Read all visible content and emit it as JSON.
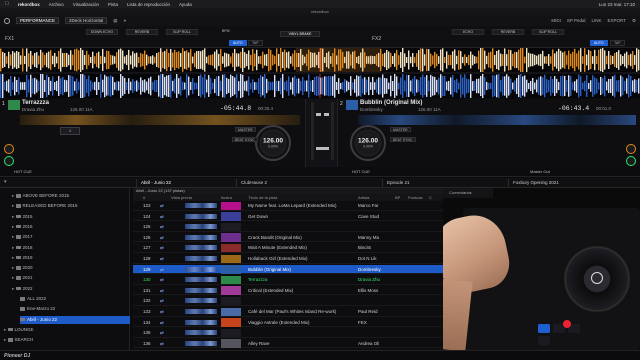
{
  "menubar": {
    "app": "rekordbox",
    "items": [
      "Archivo",
      "Visualización",
      "Pista",
      "Lista de reproducción",
      "Ayuda"
    ],
    "clock": "Lun 23 mar. 17:10"
  },
  "titlebar": {
    "title": "rekordbox"
  },
  "toolbar": {
    "mode": "PERFORMANCE",
    "layout": "2Deck Horizontal",
    "right_items": [
      "MIDI",
      "SP Pedal",
      "LINK",
      "EXPORT"
    ]
  },
  "fx": {
    "fx1": "FX1",
    "fx2": "FX2",
    "left_slots": [
      "DOWN ECHO",
      "REVERB",
      "SLIP ROLL"
    ],
    "right_slots": [
      "ECHO",
      "REVERB",
      "SLIP ROLL"
    ],
    "auto": "AUTO",
    "tap": "TAP",
    "bpm_label": "BPM",
    "center": "VINYL BRAKE"
  },
  "deck_a": {
    "number": "1",
    "title": "Terrazzza",
    "artist": "Dravia Zhu",
    "key_bpm": "126.00 11A",
    "remain": "-05:44.8",
    "elapsed": "00:30.4",
    "bpm": "126.00",
    "pct": "0.00%",
    "master": "MASTER",
    "beat_sync": "BEAT SYNC",
    "loop": "4",
    "hotcue": "HOT CUE"
  },
  "deck_b": {
    "number": "2",
    "title": "Bubblin (Original Mix)",
    "artist": "Dombresky",
    "key_bpm": "126.00 11A",
    "remain": "-06:43.4",
    "elapsed": "00:01.0",
    "bpm": "126.00",
    "pct": "0.00%",
    "master": "MASTER",
    "beat_sync": "BEAT SYNC",
    "hotcue": "HOT CUE"
  },
  "master_out": "Master Out",
  "browser": {
    "tabs": [
      "Abril - Junio 22",
      "ClubHause 2",
      "Episode 21",
      "Foxbury Opening 2021"
    ],
    "playlist_title": "Abril - Junio 22 (137 pistas)",
    "columns": [
      "#",
      "Vista previa",
      "Ilustra",
      "Título de la pista",
      "Artista",
      "BP",
      "Puntuac",
      "C",
      "Comentarios"
    ]
  },
  "tree": [
    {
      "label": "ABOVE BEFORE 2015",
      "indent": 1
    },
    {
      "label": "RELEASED BEFORE 2015",
      "indent": 1
    },
    {
      "label": "2015",
      "indent": 1
    },
    {
      "label": "2016",
      "indent": 1
    },
    {
      "label": "2017",
      "indent": 1
    },
    {
      "label": "2018",
      "indent": 1
    },
    {
      "label": "2019",
      "indent": 1
    },
    {
      "label": "2020",
      "indent": 1
    },
    {
      "label": "2021",
      "indent": 1
    },
    {
      "label": "2022",
      "indent": 1
    },
    {
      "label": "ALL 2022",
      "indent": 2
    },
    {
      "label": "Ene-Marzo 22",
      "indent": 2
    },
    {
      "label": "Abril - Junio 22",
      "indent": 2,
      "selected": true
    },
    {
      "label": "LOUNGE",
      "indent": 0
    },
    {
      "label": "SEARCH",
      "indent": 0
    }
  ],
  "tracks": [
    {
      "num": "123",
      "title": "My Name feat. LoMa Lepard (Extended Mix)",
      "artist": "Marco Far",
      "art": "#b8108c"
    },
    {
      "num": "124",
      "title": "Get Down",
      "artist": "Cave Stud",
      "art": "#3b3f9a"
    },
    {
      "num": "125",
      "title": "",
      "artist": "",
      "art": "#1c1c22"
    },
    {
      "num": "126",
      "title": "Crack Bandit (Original Mix)",
      "artist": "Manny Ma",
      "art": "#6d2e8e"
    },
    {
      "num": "127",
      "title": "Wait A Minute (Extended Mix)",
      "artist": "Biscits",
      "art": "#8a2c2c"
    },
    {
      "num": "128",
      "title": "Hollaback Girl (Extended Mix)",
      "artist": "Dot N Lik",
      "art": "#9a6a1a"
    },
    {
      "num": "129",
      "title": "Bubblin (Original Mix)",
      "artist": "Dombresky",
      "art": "#2a5fa8",
      "selected": true
    },
    {
      "num": "130",
      "title": "Terrazzza",
      "artist": "Dravia Zhu",
      "art": "#2e8a4a",
      "green": true
    },
    {
      "num": "131",
      "title": "Critical (Extended Mix)",
      "artist": "Ellis Moss",
      "art": "#a23a9a"
    },
    {
      "num": "132",
      "title": "",
      "artist": "",
      "art": "#1c1c22"
    },
    {
      "num": "133",
      "title": "Café del Mar (Paul's Whites Island Re-work)",
      "artist": "Paul Reid",
      "art": "#4a6aa8"
    },
    {
      "num": "134",
      "title": "Viaggio Astrale (Extended Mix)",
      "artist": "FEX",
      "art": "#c7431e"
    },
    {
      "num": "135",
      "title": "",
      "artist": "",
      "art": "#1c1c22"
    },
    {
      "num": "136",
      "title": "Alley Rave",
      "artist": "Andrea Oli",
      "art": "#555560"
    }
  ],
  "footer": {
    "brand": "Pioneer DJ"
  },
  "colors": {
    "accent": "#1e5fd1",
    "selected_row": "#1e5bc9",
    "wave_blue": "#2d63c8",
    "wave_orange": "#e2891c",
    "green_text": "#2ee66b"
  }
}
